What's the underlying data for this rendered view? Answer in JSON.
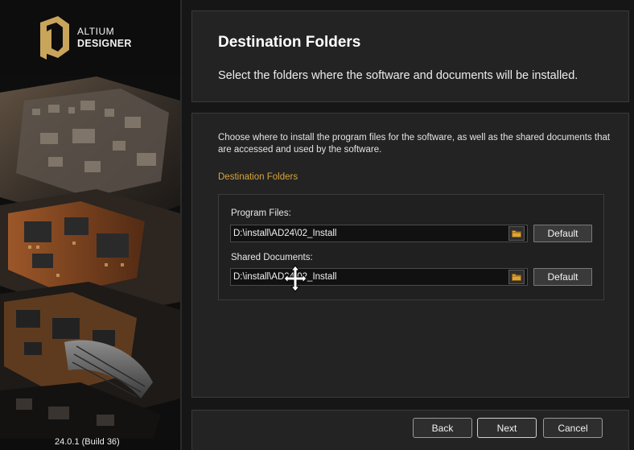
{
  "brand": {
    "line1": "ALTIUM",
    "line2": "DESIGNER",
    "version": "24.0.1 (Build 36)"
  },
  "header": {
    "title": "Destination Folders",
    "subtitle": "Select the folders where the software and documents will be installed."
  },
  "main": {
    "description": "Choose where to install the program files for the software, as well as the shared documents that are accessed and used by the software.",
    "section_label": "Destination Folders",
    "program_files": {
      "label": "Program Files:",
      "value": "D:\\install\\AD24\\02_Install",
      "default_label": "Default"
    },
    "shared_documents": {
      "label": "Shared Documents:",
      "value": "D:\\install\\AD24\\02_Install",
      "default_label": "Default"
    }
  },
  "footer": {
    "back_label": "Back",
    "next_label": "Next",
    "cancel_label": "Cancel"
  },
  "colors": {
    "accent": "#d9a43a",
    "background": "#161616",
    "panel": "#232323"
  },
  "icons": {
    "browse": "folder-icon",
    "cursor": "move-cursor-icon",
    "logo": "altium-logo-icon"
  }
}
